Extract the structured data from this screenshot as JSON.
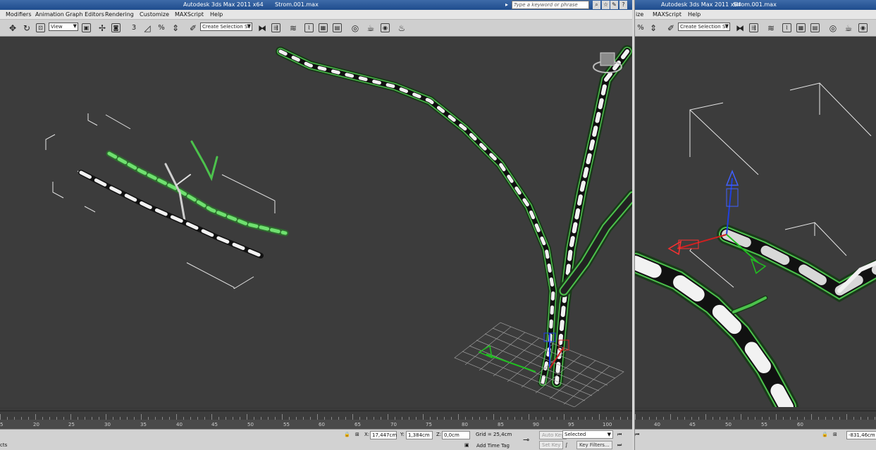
{
  "left_window": {
    "title": "Autodesk 3ds Max  2011 x64",
    "file": "Strom.001.max",
    "search_placeholder": "Type a keyword or phrase",
    "menu": [
      "Modifiers",
      "Animation",
      "Graph Editors",
      "Rendering",
      "Customize",
      "MAXScript",
      "Help"
    ],
    "view_dropdown": "View",
    "selection_set_dropdown": "Create Selection Se",
    "snap_label": "3",
    "timeline_ticks": [
      "5",
      "20",
      "25",
      "30",
      "35",
      "40",
      "45",
      "50",
      "55",
      "60",
      "65",
      "70",
      "75",
      "80",
      "85",
      "90",
      "95",
      "100"
    ],
    "status": {
      "left_text": "cts",
      "x_label": "X:",
      "x_value": "17,447cm",
      "y_label": "Y:",
      "y_value": "1,384cm",
      "z_label": "Z:",
      "z_value": "0,0cm",
      "grid": "Grid = 25,4cm",
      "add_time_tag": "Add Time Tag",
      "auto_key": "Auto Key",
      "set_key": "Set Key",
      "selected_dropdown": "Selected",
      "key_filters": "Key Filters..."
    }
  },
  "right_window": {
    "title": "Autodesk 3ds Max  2011 x64",
    "file": "Strom.001.max",
    "menu": [
      "ize",
      "MAXScript",
      "Help"
    ],
    "selection_set_dropdown": "Create Selection Se",
    "timeline_ticks": [
      "40",
      "45",
      "50",
      "55",
      "60"
    ],
    "status": {
      "x_value": "-831,46cm"
    }
  },
  "colors": {
    "viewport_bg": "#3c3c3c",
    "wire_green": "#4cc24c",
    "gizmo_red": "#d02020",
    "gizmo_blue": "#2040e0",
    "gizmo_green": "#20c020"
  },
  "icons": [
    "move-icon",
    "rotate-icon",
    "scale-icon",
    "snap-icon",
    "mirror-icon",
    "align-icon",
    "layer-icon",
    "render-icon",
    "teapot-icon"
  ]
}
